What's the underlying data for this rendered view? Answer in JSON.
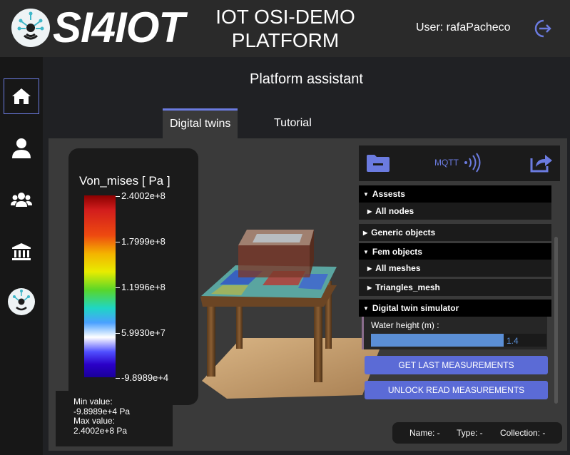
{
  "header": {
    "logo_text": "SI4IOT",
    "title": "IOT OSI-DEMO PLATFORM",
    "user_label": "User: rafaPacheco"
  },
  "sidebar": {
    "items": [
      {
        "icon": "home-icon",
        "active": true
      },
      {
        "icon": "user-icon"
      },
      {
        "icon": "users-icon"
      },
      {
        "icon": "bank-icon"
      },
      {
        "icon": "logo-icon"
      }
    ]
  },
  "main": {
    "title": "Platform assistant",
    "tabs": [
      {
        "label": "Digital twins",
        "active": true
      },
      {
        "label": "Tutorial"
      }
    ]
  },
  "legend": {
    "title": "Von_mises [ Pa ]",
    "ticks": [
      "2.4002e+8",
      "1.7999e+8",
      "1.1996e+8",
      "5.9930e+7",
      "-9.8989e+4"
    ],
    "min_label": "Min value:",
    "min_value": "-9.8989e+4 Pa",
    "max_label": "Max value:",
    "max_value": "2.4002e+8 Pa"
  },
  "panel": {
    "mqtt_label": "MQTT",
    "sections": {
      "assets": "Assests",
      "all_nodes": "All nodes",
      "generic_objects": "Generic objects",
      "fem_objects": "Fem objects",
      "all_meshes": "All meshes",
      "triangles_mesh": "Triangles_mesh",
      "simulator": "Digital twin simulator"
    },
    "water_label": "Water height (m) :",
    "water_value": "1.4",
    "buttons": {
      "get_last": "GET LAST MEASUREMENTS",
      "unlock": "UNLOCK READ MEASUREMENTS"
    }
  },
  "info_bar": {
    "name": "Name: -",
    "type": "Type: -",
    "collection": "Collection: -"
  },
  "colors": {
    "accent": "#6b7be0",
    "button": "#5b6bd6",
    "header_bg": "#2a2a2a",
    "sidebar_bg": "#171717"
  }
}
